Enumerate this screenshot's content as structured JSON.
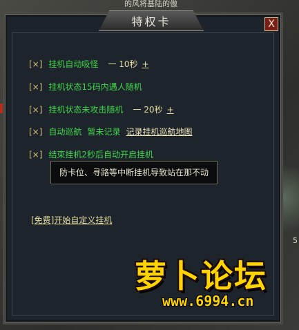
{
  "scene": {
    "top_text": "的风将基陆的傲",
    "right_number": "5"
  },
  "dialog": {
    "title": "特权卡",
    "close_glyph": "X",
    "options": [
      {
        "check": "[×]",
        "label": "挂机自动吸怪",
        "value": "一 10秒",
        "plus": "+"
      },
      {
        "check": "[×]",
        "label": "挂机状态15码内遇人随机"
      },
      {
        "check": "[×]",
        "label": "挂机状态未攻击随机",
        "value": "一 20秒",
        "plus": "+"
      },
      {
        "check": "[×]",
        "label": "自动巡航",
        "status": "暂未记录",
        "link": "记录挂机巡航地图"
      },
      {
        "check": "[×]",
        "label": "结束挂机2秒后自动开启挂机"
      }
    ],
    "tooltip": "防卡位、寻路等中断挂机导致站在那不动",
    "free_link": "[免费]开始自定义挂机"
  },
  "watermark": {
    "logo_text": "萝卜论坛",
    "url": "www.6994.cn"
  }
}
